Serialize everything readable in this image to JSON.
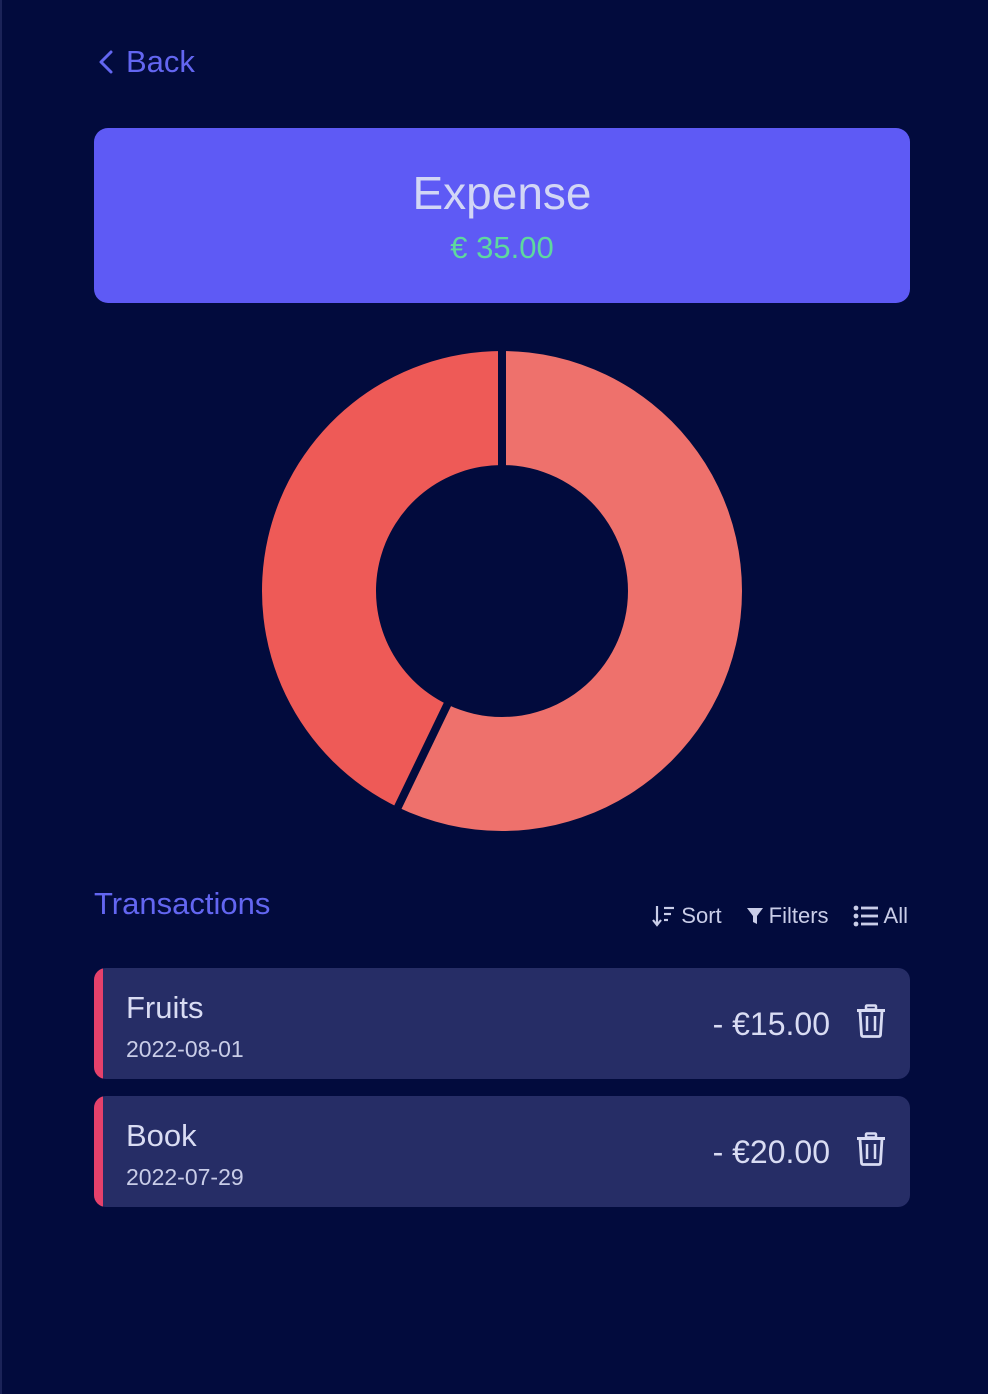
{
  "nav": {
    "back_label": "Back"
  },
  "summary": {
    "title": "Expense",
    "amount": "€ 35.00"
  },
  "chart_data": {
    "type": "pie",
    "variant": "donut",
    "categories": [
      "Fruits",
      "Book"
    ],
    "values": [
      15,
      20
    ],
    "colors": [
      "#ee5a57",
      "#ee716c"
    ]
  },
  "transactions": {
    "title": "Transactions",
    "toolbar": {
      "sort_label": "Sort",
      "filters_label": "Filters",
      "all_label": "All"
    },
    "items": [
      {
        "name": "Fruits",
        "date": "2022-08-01",
        "amount": "- €15.00"
      },
      {
        "name": "Book",
        "date": "2022-07-29",
        "amount": "- €20.00"
      }
    ]
  },
  "colors": {
    "background": "#020b3d",
    "accent": "#6366f1",
    "card": "#5e5af5",
    "positive": "#5ed89e",
    "row": "#262d66",
    "expense_marker": "#e5416b"
  }
}
